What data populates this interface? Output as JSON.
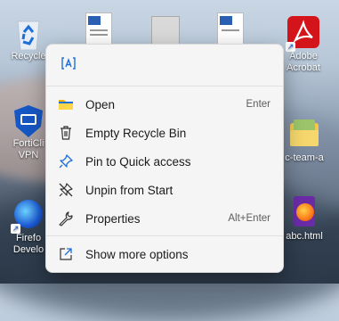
{
  "desktop": {
    "icons": [
      {
        "label": "Recycle Bin",
        "visible": "Recycle",
        "icon": "recycle-bin-icon"
      },
      {
        "label": "Adobe Acrobat",
        "visible": "Adobe\nAcrobat",
        "icon": "adobe-acrobat-icon"
      },
      {
        "label": "FortiClient VPN",
        "visible": "FortiCli\nVPN",
        "icon": "forticlient-icon"
      },
      {
        "label": "c-team-a",
        "visible": "c-team-a",
        "icon": "folder-icon"
      },
      {
        "label": "Firefox Developer",
        "visible": "Firefo\nDevelo",
        "icon": "firefox-developer-icon"
      },
      {
        "label": "abc.html",
        "visible": "abc.html",
        "icon": "firefox-html-icon"
      }
    ]
  },
  "context_menu": {
    "top_icons": [
      {
        "icon": "ai-rename-icon"
      }
    ],
    "items": [
      {
        "label": "Open",
        "shortcut": "Enter",
        "icon": "folder-open-icon"
      },
      {
        "label": "Empty Recycle Bin",
        "shortcut": "",
        "icon": "trash-icon"
      },
      {
        "label": "Pin to Quick access",
        "shortcut": "",
        "icon": "pin-icon"
      },
      {
        "label": "Unpin from Start",
        "shortcut": "",
        "icon": "unpin-icon"
      },
      {
        "label": "Properties",
        "shortcut": "Alt+Enter",
        "icon": "wrench-icon"
      }
    ],
    "footer": {
      "label": "Show more options",
      "icon": "share-icon"
    }
  },
  "colors": {
    "menu_bg": "#f5f5f6",
    "accent": "#1e6fd9",
    "adobe_red": "#d3151b"
  }
}
